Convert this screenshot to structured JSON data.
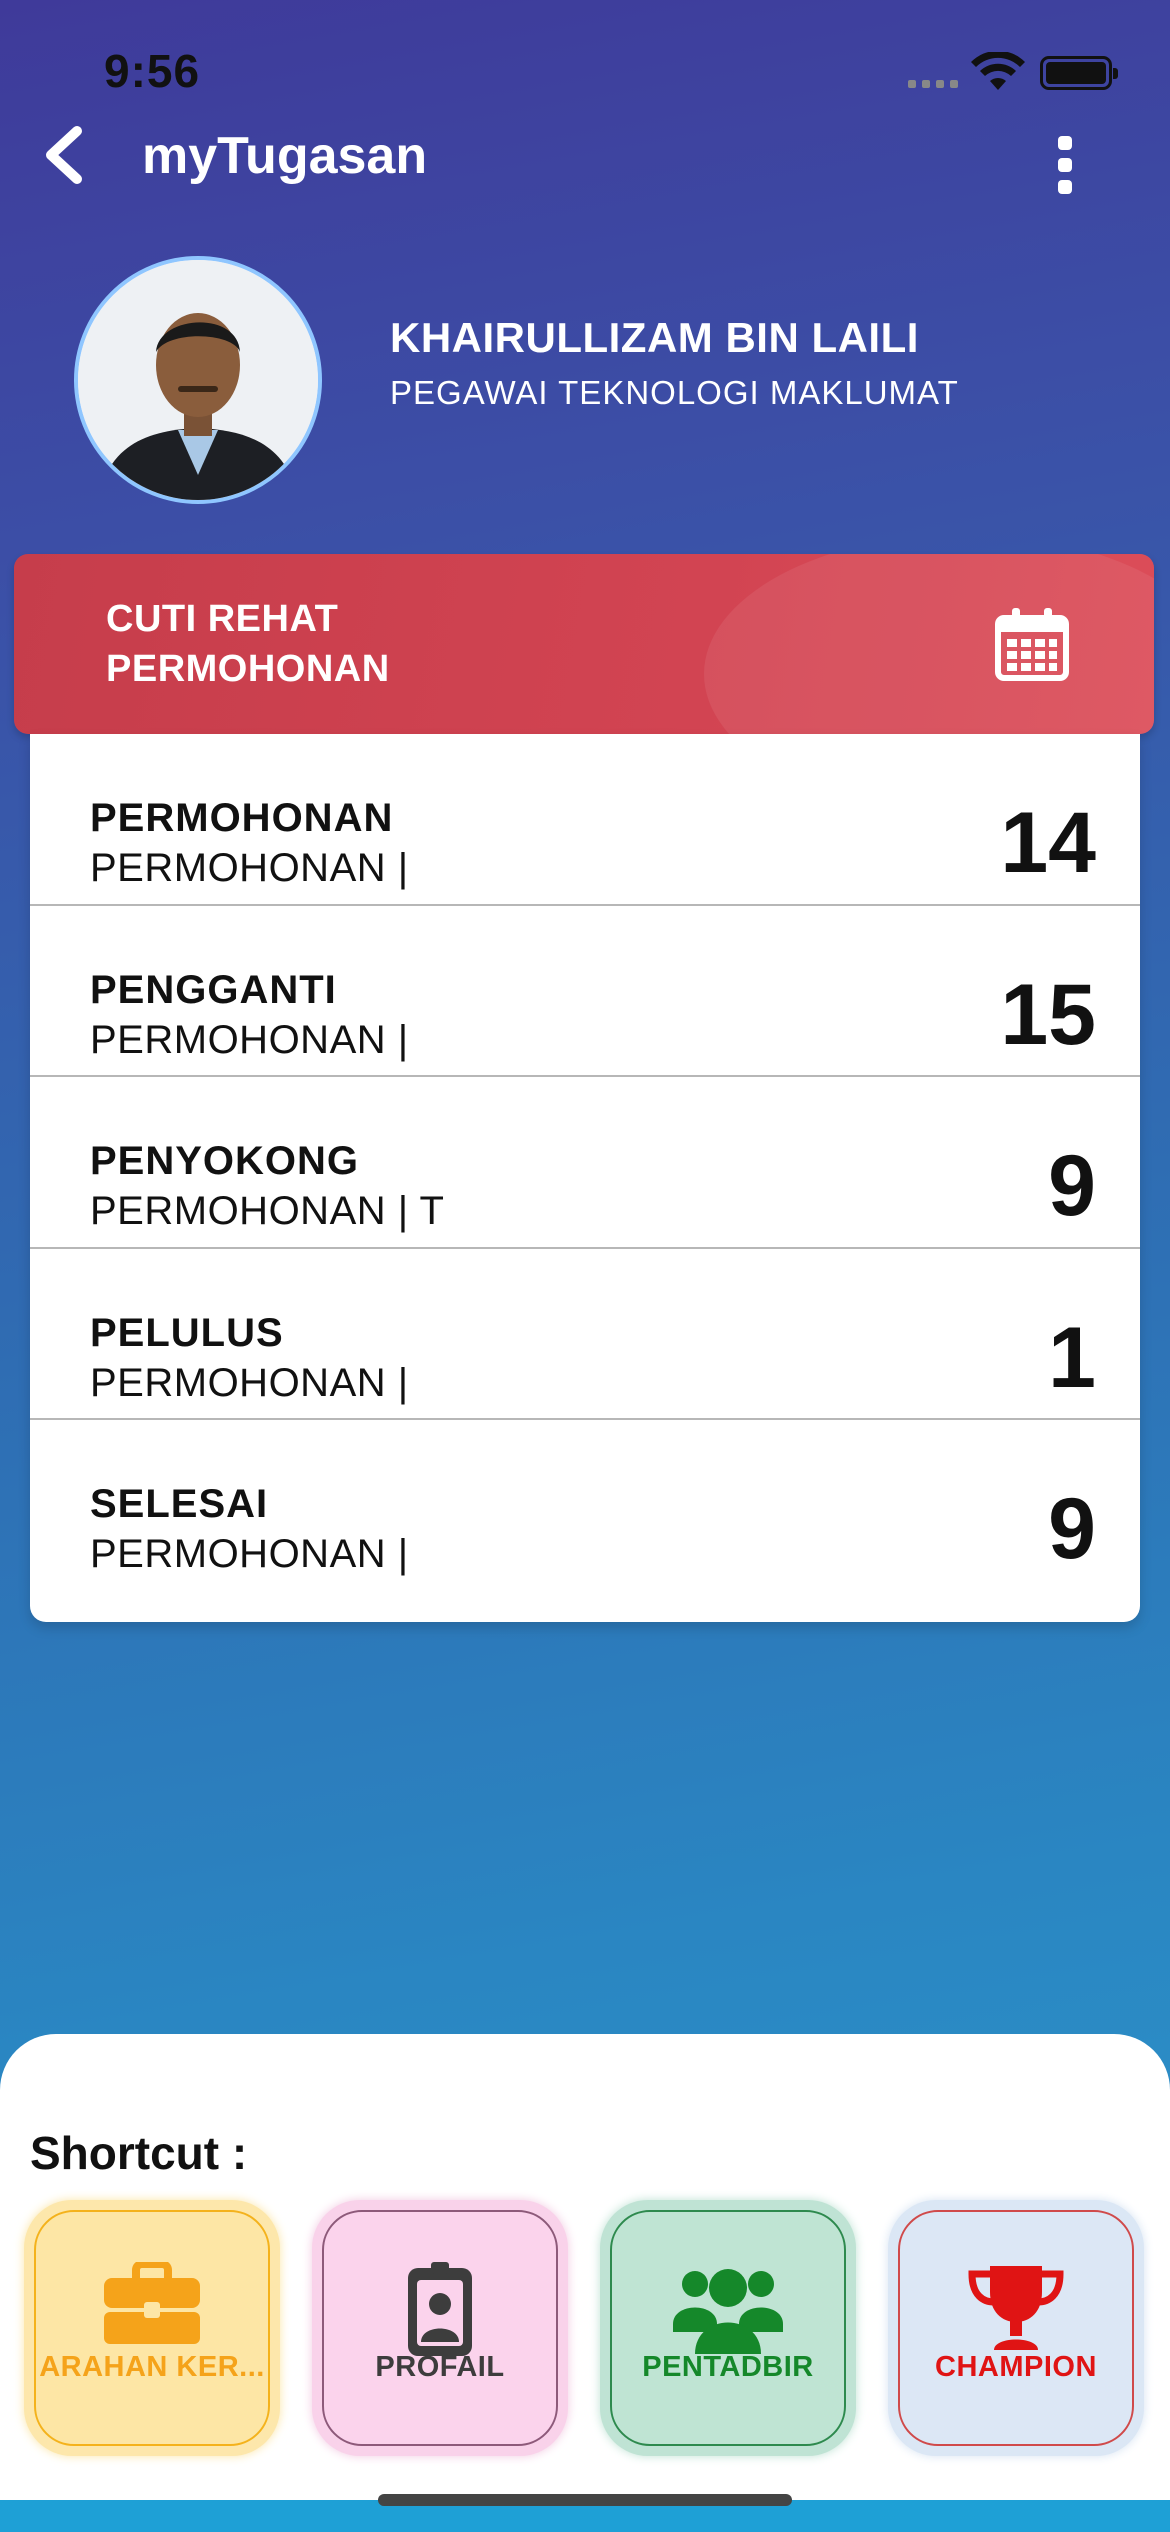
{
  "status_bar": {
    "time": "9:56"
  },
  "nav": {
    "title": "myTugasan",
    "back_icon": "chevron-left-icon",
    "menu_icon": "more-vertical-icon"
  },
  "user": {
    "name": "KHAIRULLIZAM BIN LAILI",
    "role": "PEGAWAI TEKNOLOGI MAKLUMAT"
  },
  "leave_card": {
    "line1": "CUTI REHAT",
    "line2": "PERMOHONAN",
    "icon": "calendar-icon",
    "color": "#d24452"
  },
  "stats": [
    {
      "label": "PERMOHONAN",
      "sub": "PERMOHONAN |",
      "value": "14"
    },
    {
      "label": "PENGGANTI",
      "sub": "PERMOHONAN |",
      "value": "15"
    },
    {
      "label": "PENYOKONG",
      "sub": "PERMOHONAN | T",
      "value": "9"
    },
    {
      "label": "PELULUS",
      "sub": "PERMOHONAN |",
      "value": "1"
    },
    {
      "label": "SELESAI",
      "sub": "PERMOHONAN |",
      "value": "9"
    }
  ],
  "shortcut": {
    "title": "Shortcut :",
    "items": [
      {
        "label": "ARAHAN KER...",
        "icon": "briefcase-icon",
        "color": "#f5a31a"
      },
      {
        "label": "PROFAIL",
        "icon": "id-badge-icon",
        "color": "#3d3d3d"
      },
      {
        "label": "PENTADBIR",
        "icon": "users-icon",
        "color": "#15882a"
      },
      {
        "label": "CHAMPION",
        "icon": "trophy-icon",
        "color": "#e01414"
      }
    ]
  }
}
